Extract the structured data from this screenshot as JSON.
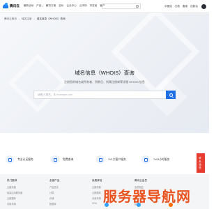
{
  "brand": {
    "logo_text": "腾讯云"
  },
  "nav": {
    "items": [
      "最新活动",
      "产品",
      "解决方案",
      "定价",
      "企业中心",
      "云市场",
      "开发者",
      "客户"
    ],
    "right": [
      "中国站",
      "文档",
      "备案",
      "控制台"
    ]
  },
  "breadcrumb": {
    "items": [
      "腾讯云首页",
      "域名注册",
      "域名信息（WHOIS）查询"
    ]
  },
  "hero": {
    "title": "域名信息（WHOIS）查询",
    "subtitle": "注册您的域名或所有者、到期日、所属注册商等详细 WHOIS 信息",
    "search_placeholder": "请输入域名，如 example.com"
  },
  "features": [
    {
      "label": "专业认证服务",
      "icon": "badge-icon"
    },
    {
      "label": "免费查询",
      "icon": "search-icon"
    },
    {
      "label": "1V1大客户服务",
      "icon": "user-icon"
    },
    {
      "label": "7x24小时服务",
      "icon": "clock-icon"
    }
  ],
  "float": {
    "label": "联系销售"
  },
  "footer": {
    "columns": [
      {
        "title": "热门推荐",
        "links": [
          "云服务器",
          "轻量应用服务器",
          "云数据库",
          "对象存储"
        ]
      },
      {
        "title": "全部产品",
        "links": [
          "产品总览",
          "计算",
          "存储",
          "数据库"
        ]
      },
      {
        "title": "免费体验",
        "links": [
          "云服务器",
          "云数据库",
          "对象存储",
          "CDN"
        ]
      },
      {
        "title": "腾讯云会员",
        "links": [
          "会员权益",
          "新手入门",
          "积分中心",
          "福利"
        ]
      },
      {
        "title": "关注腾讯云官方",
        "links": [
          "微信公众号",
          "微博",
          "社区",
          "视频号"
        ]
      }
    ]
  },
  "watermark": {
    "text": "服务器导航网",
    "dot_colors": [
      "#2fa4ff",
      "#2fa4ff",
      "#ff6a00"
    ]
  },
  "colors": {
    "accent": "#1e6fe6",
    "float_red": "#e63b2e",
    "watermark": "#e8531f"
  }
}
